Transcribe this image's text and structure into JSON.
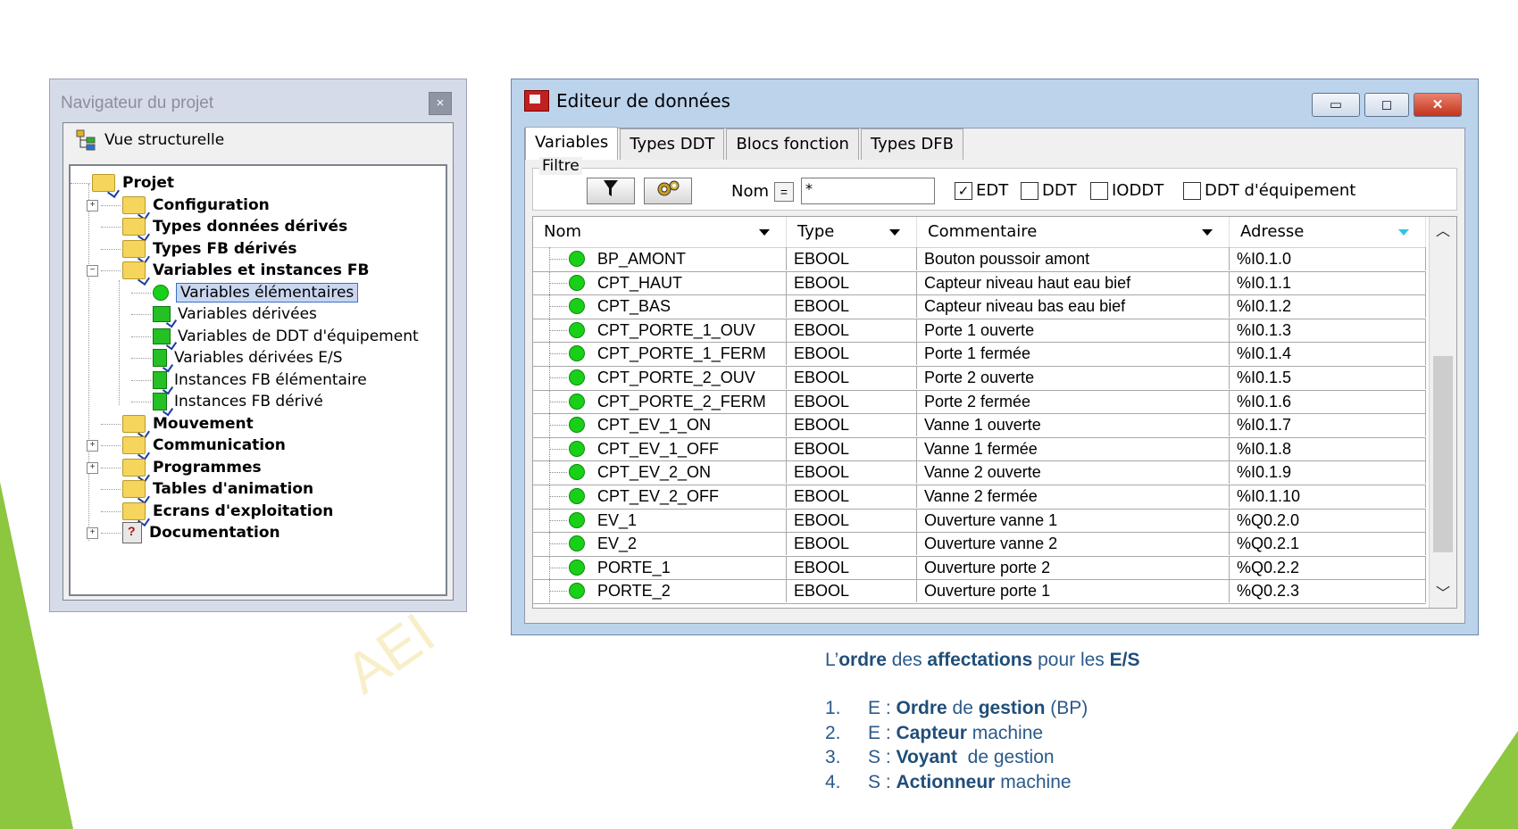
{
  "watermark": "AEI",
  "navigator": {
    "title": "Navigateur du projet",
    "close": "×",
    "view_label": "Vue structurelle",
    "tree": [
      {
        "label": "Projet",
        "bold": true
      },
      {
        "label": "Configuration",
        "bold": true
      },
      {
        "label": "Types données dérivés",
        "bold": true
      },
      {
        "label": "Types FB dérivés",
        "bold": true
      },
      {
        "label": "Variables et instances FB",
        "bold": true
      },
      {
        "label": "Variables élémentaires",
        "bold": false,
        "selected": true
      },
      {
        "label": "Variables dérivées",
        "bold": false
      },
      {
        "label": "Variables de DDT d'équipement",
        "bold": false
      },
      {
        "label": "Variables dérivées E/S",
        "bold": false
      },
      {
        "label": "Instances FB élémentaire",
        "bold": false
      },
      {
        "label": "Instances FB dérivé",
        "bold": false
      },
      {
        "label": "Mouvement",
        "bold": true
      },
      {
        "label": "Communication",
        "bold": true
      },
      {
        "label": "Programmes",
        "bold": true
      },
      {
        "label": "Tables d'animation",
        "bold": true
      },
      {
        "label": "Ecrans d'exploitation",
        "bold": true
      },
      {
        "label": "Documentation",
        "bold": true
      }
    ]
  },
  "editor": {
    "title": "Editeur de données",
    "tabs": [
      "Variables",
      "Types DDT",
      "Blocs fonction",
      "Types DFB"
    ],
    "filter": {
      "label": "Filtre",
      "nom_label": "Nom",
      "eq": "=",
      "input_value": "*",
      "checks": [
        {
          "label": "EDT",
          "checked": true
        },
        {
          "label": "DDT",
          "checked": false
        },
        {
          "label": "IODDT",
          "checked": false
        },
        {
          "label": "DDT d'équipement",
          "checked": false
        }
      ]
    },
    "columns": [
      "Nom",
      "Type",
      "Commentaire",
      "Adresse"
    ],
    "rows": [
      {
        "nom": "BP_AMONT",
        "type": "EBOOL",
        "commentaire": "Bouton poussoir amont",
        "adresse": "%I0.1.0"
      },
      {
        "nom": "CPT_HAUT",
        "type": "EBOOL",
        "commentaire": "Capteur niveau haut eau bief",
        "adresse": "%I0.1.1"
      },
      {
        "nom": "CPT_BAS",
        "type": "EBOOL",
        "commentaire": "Capteur niveau bas eau bief",
        "adresse": "%I0.1.2"
      },
      {
        "nom": "CPT_PORTE_1_OUV",
        "type": "EBOOL",
        "commentaire": "Porte 1 ouverte",
        "adresse": "%I0.1.3"
      },
      {
        "nom": "CPT_PORTE_1_FERM",
        "type": "EBOOL",
        "commentaire": "Porte 1 fermée",
        "adresse": "%I0.1.4"
      },
      {
        "nom": "CPT_PORTE_2_OUV",
        "type": "EBOOL",
        "commentaire": "Porte 2 ouverte",
        "adresse": "%I0.1.5"
      },
      {
        "nom": "CPT_PORTE_2_FERM",
        "type": "EBOOL",
        "commentaire": "Porte 2 fermée",
        "adresse": "%I0.1.6"
      },
      {
        "nom": "CPT_EV_1_ON",
        "type": "EBOOL",
        "commentaire": "Vanne 1 ouverte",
        "adresse": "%I0.1.7"
      },
      {
        "nom": "CPT_EV_1_OFF",
        "type": "EBOOL",
        "commentaire": "Vanne 1 fermée",
        "adresse": "%I0.1.8"
      },
      {
        "nom": "CPT_EV_2_ON",
        "type": "EBOOL",
        "commentaire": "Vanne 2 ouverte",
        "adresse": "%I0.1.9"
      },
      {
        "nom": "CPT_EV_2_OFF",
        "type": "EBOOL",
        "commentaire": "Vanne 2 fermée",
        "adresse": "%I0.1.10"
      },
      {
        "nom": "EV_1",
        "type": "EBOOL",
        "commentaire": "Ouverture vanne 1",
        "adresse": "%Q0.2.0"
      },
      {
        "nom": "EV_2",
        "type": "EBOOL",
        "commentaire": "Ouverture vanne 2",
        "adresse": "%Q0.2.1"
      },
      {
        "nom": "PORTE_1",
        "type": "EBOOL",
        "commentaire": "Ouverture porte 2",
        "adresse": "%Q0.2.2"
      },
      {
        "nom": "PORTE_2",
        "type": "EBOOL",
        "commentaire": "Ouverture porte 1",
        "adresse": "%Q0.2.3"
      }
    ]
  },
  "note": {
    "title_parts": [
      "L’",
      "ordre",
      " des ",
      "affectations",
      " pour les ",
      "E/S"
    ],
    "items": [
      {
        "num": "1.",
        "parts": [
          "E : ",
          "Ordre",
          " de ",
          "gestion",
          " (BP)"
        ]
      },
      {
        "num": "2.",
        "parts": [
          "E : ",
          "Capteur",
          " machine"
        ]
      },
      {
        "num": "3.",
        "parts": [
          "S : ",
          "Voyant",
          "  de gestion"
        ]
      },
      {
        "num": "4.",
        "parts": [
          "S : ",
          "Actionneur",
          " machine"
        ]
      }
    ]
  }
}
